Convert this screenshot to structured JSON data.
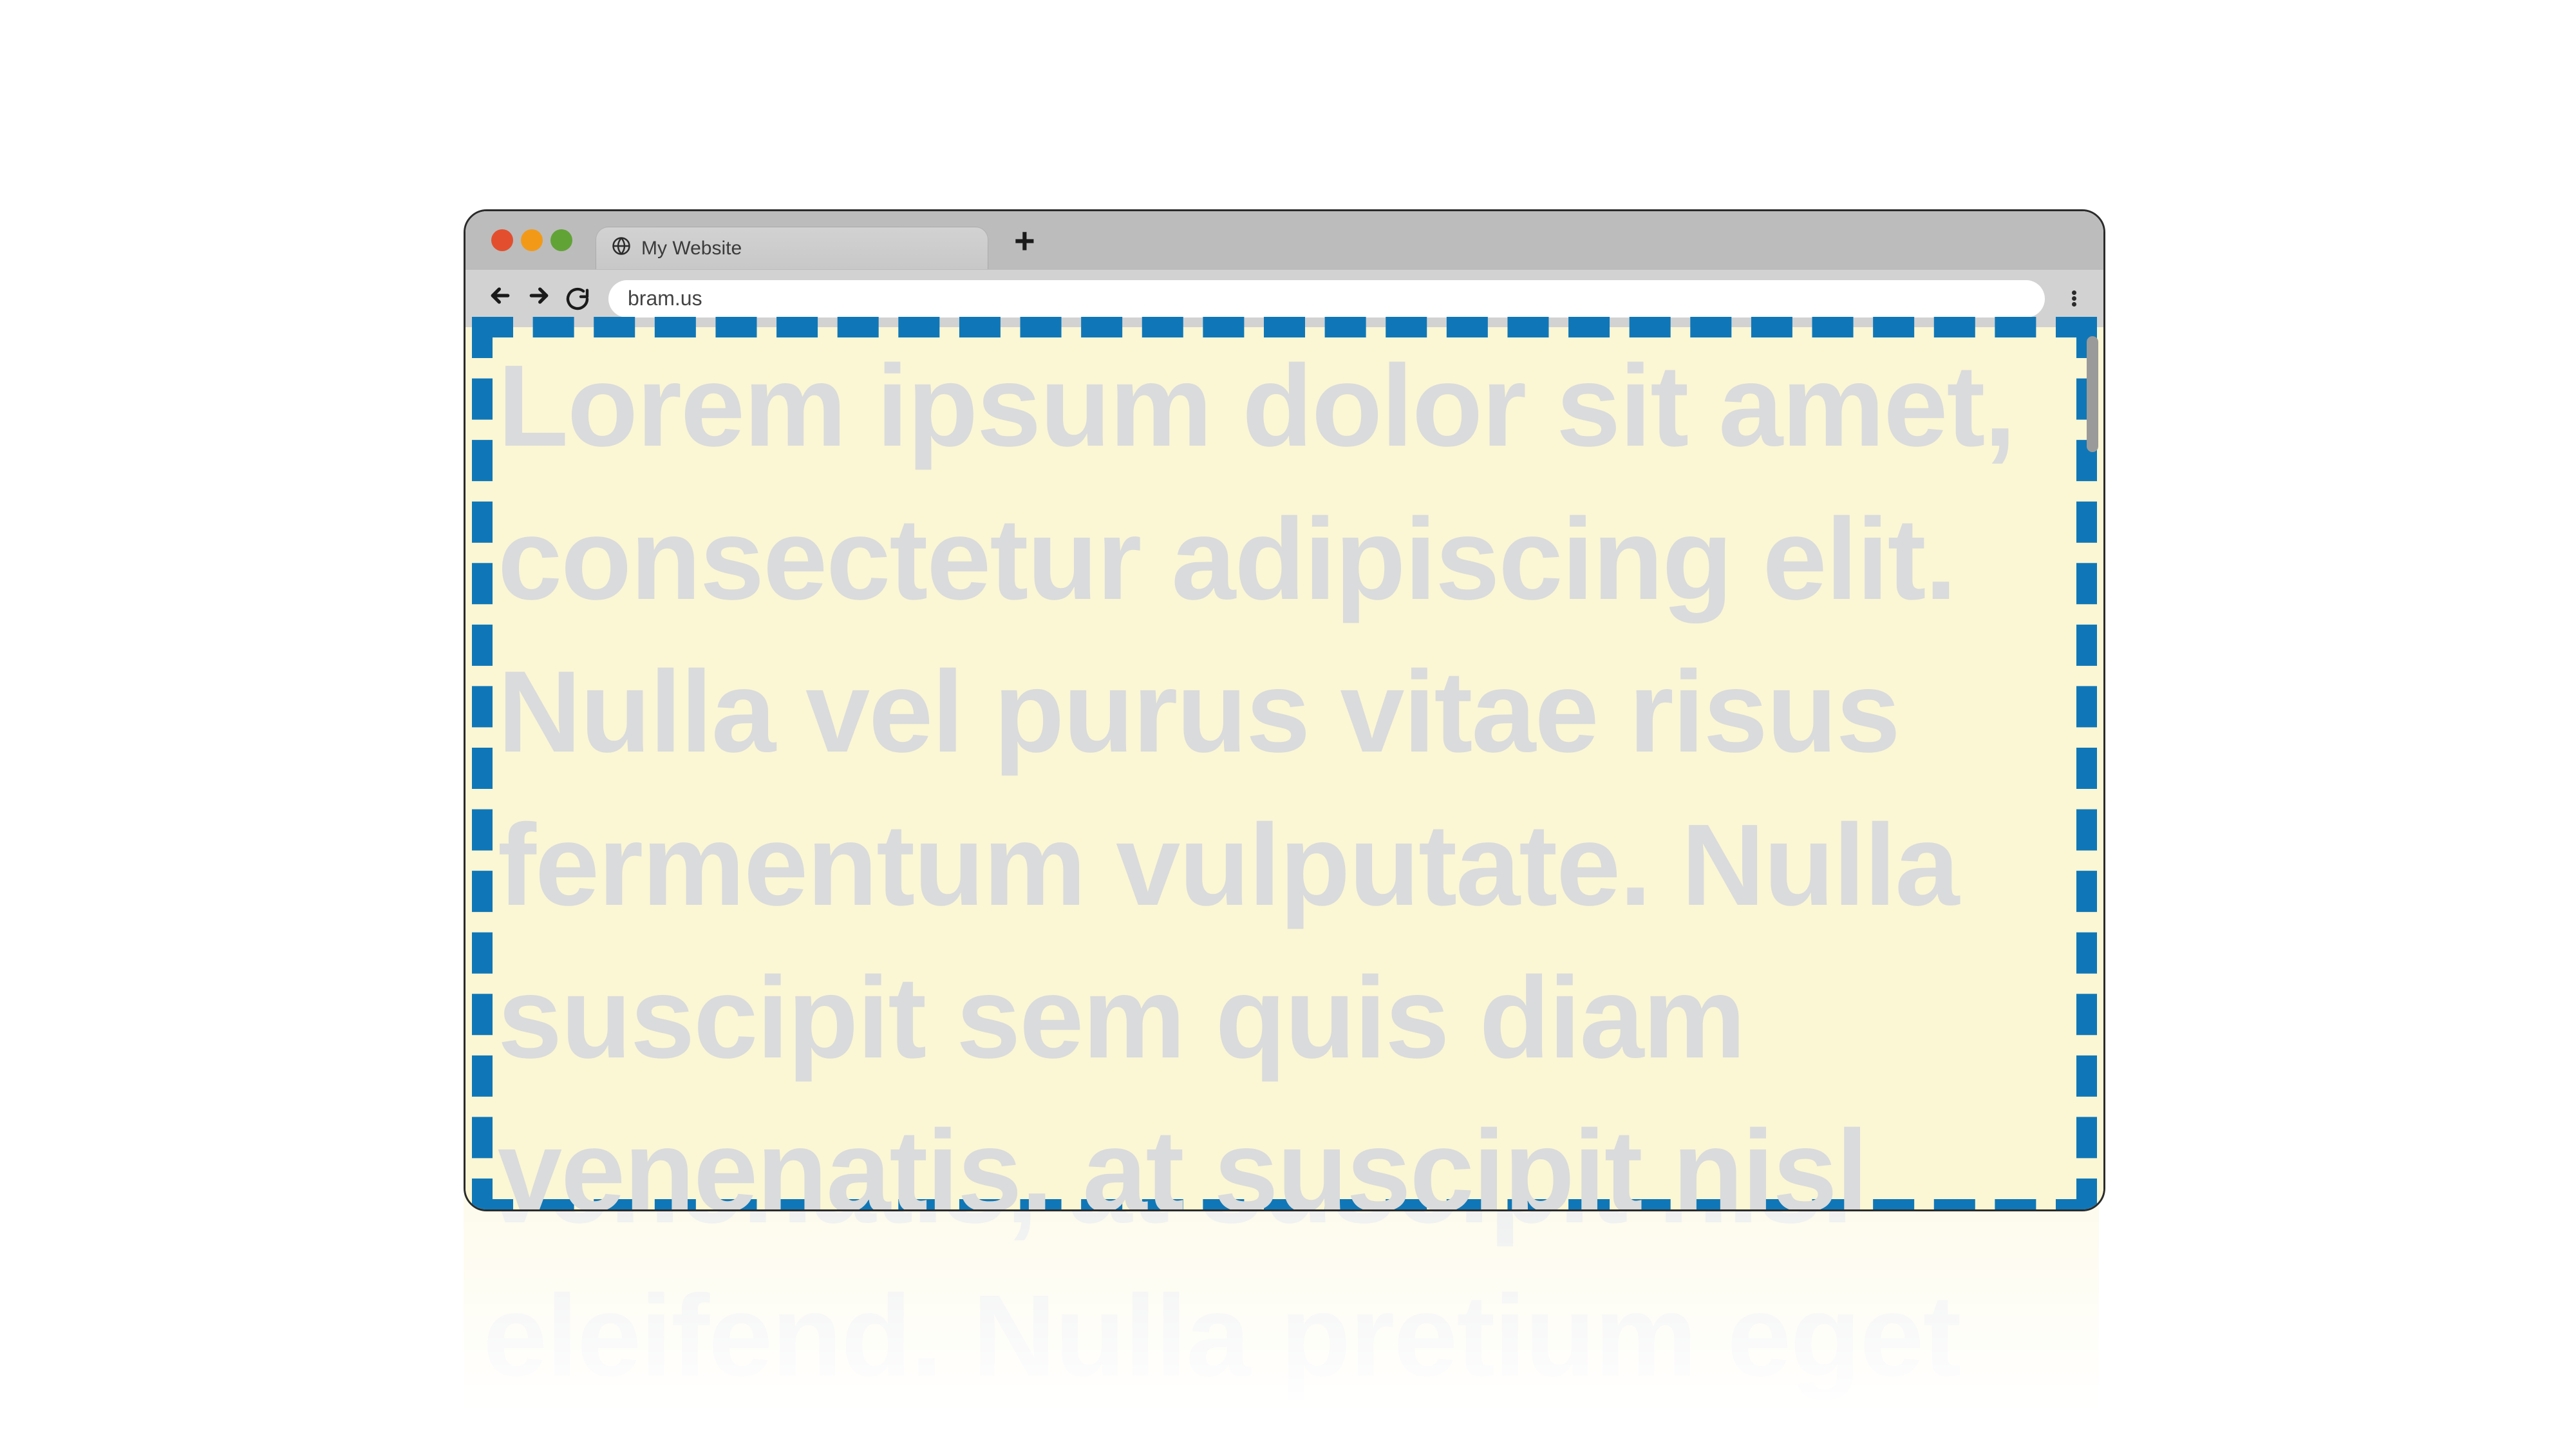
{
  "browser": {
    "tab_title": "My Website",
    "url": "bram.us"
  },
  "traffic_lights": {
    "close": "#e34f2e",
    "minimize": "#f29a18",
    "zoom": "#62a336"
  },
  "page": {
    "body_text": "Lorem ipsum dolor sit amet, consectetur adipiscing elit. Nulla vel purus vitae risus fermentum vulputate. Nulla suscipit sem quis diam venenatis, at suscipit nisl eleifend. Nulla pretium eget"
  },
  "colors": {
    "viewport_bg": "#fbf6d4",
    "dashed_border": "#0f77b7",
    "text_placeholder": "#d9dbdc"
  }
}
